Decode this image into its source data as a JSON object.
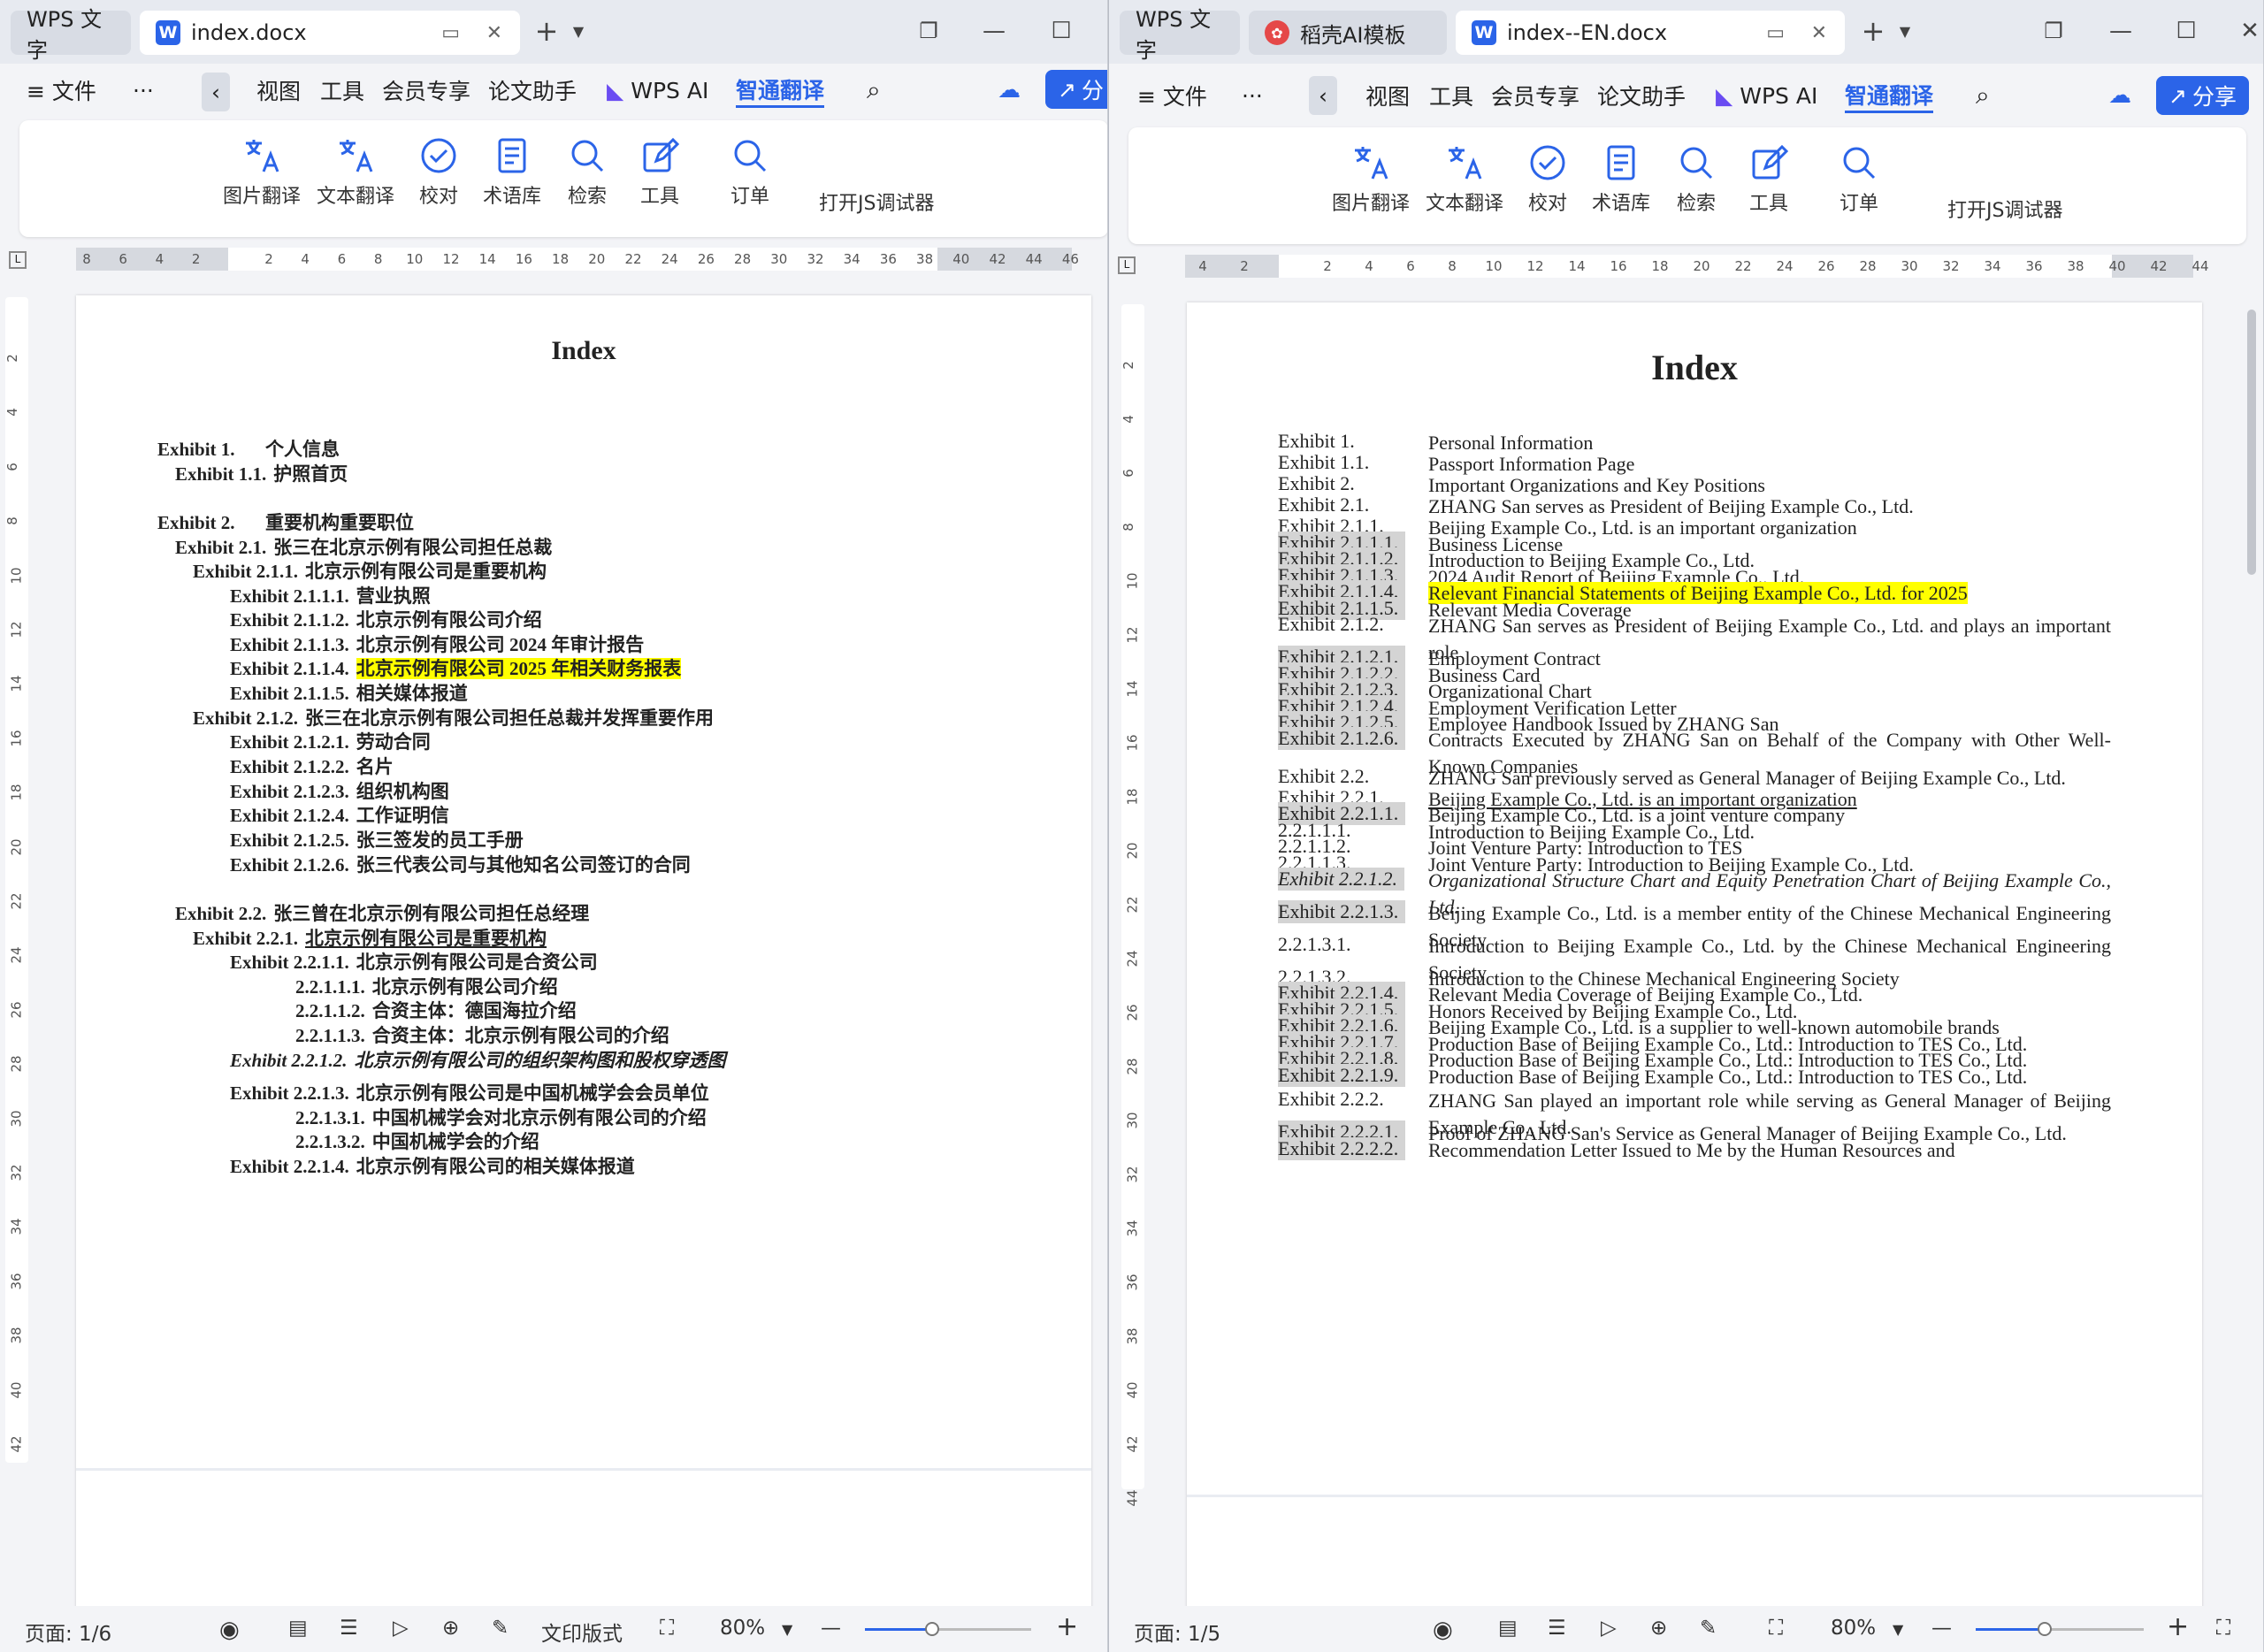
{
  "left": {
    "home_tab": "WPS 文字",
    "doc_tab": "index.docx",
    "menu": {
      "items": [
        "≡  文件",
        "···",
        "视图",
        "工具",
        "会员专享",
        "论文助手",
        "WPS AI",
        "智通翻译"
      ],
      "share_label": "分"
    },
    "ribbon": [
      "图片翻译",
      "文本翻译",
      "校对",
      "术语库",
      "检索",
      "工具",
      "订单",
      "打开JS调试器"
    ],
    "ruler_h": [
      "8",
      "6",
      "4",
      "2",
      "",
      "2",
      "4",
      "6",
      "8",
      "10",
      "12",
      "14",
      "16",
      "18",
      "20",
      "22",
      "24",
      "26",
      "28",
      "30",
      "32",
      "34",
      "36",
      "38",
      "40",
      "42",
      "44",
      "46"
    ],
    "ruler_v": [
      "2",
      "4",
      "6",
      "8",
      "10",
      "12",
      "14",
      "16",
      "18",
      "20",
      "22",
      "24",
      "26",
      "28",
      "30",
      "32",
      "34",
      "36",
      "38",
      "40",
      "42"
    ],
    "doc_title": "Index",
    "entries": [
      {
        "label": "Exhibit 1.",
        "text": "个人信息"
      },
      {
        "label": "Exhibit 1.1.",
        "text": "护照首页"
      },
      {
        "label": "Exhibit 2.",
        "text": "重要机构重要职位"
      },
      {
        "label": "Exhibit 2.1.",
        "text": "张三在北京示例有限公司担任总裁"
      },
      {
        "label": "Exhibit 2.1.1.",
        "text": "北京示例有限公司是重要机构"
      },
      {
        "label": "Exhibit 2.1.1.1.",
        "text": "营业执照"
      },
      {
        "label": "Exhibit 2.1.1.2.",
        "text": "北京示例有限公司介绍"
      },
      {
        "label": "Exhibit 2.1.1.3.",
        "text": "北京示例有限公司 2024 年审计报告"
      },
      {
        "label": "Exhibit 2.1.1.4.",
        "text": "北京示例有限公司 2025 年相关财务报表"
      },
      {
        "label": "Exhibit 2.1.1.5.",
        "text": "相关媒体报道"
      },
      {
        "label": "Exhibit 2.1.2.",
        "text": "张三在北京示例有限公司担任总裁并发挥重要作用"
      },
      {
        "label": "Exhibit 2.1.2.1.",
        "text": "劳动合同"
      },
      {
        "label": "Exhibit 2.1.2.2.",
        "text": "名片"
      },
      {
        "label": "Exhibit 2.1.2.3.",
        "text": "组织机构图"
      },
      {
        "label": "Exhibit 2.1.2.4.",
        "text": "工作证明信"
      },
      {
        "label": "Exhibit 2.1.2.5.",
        "text": "张三签发的员工手册"
      },
      {
        "label": "Exhibit 2.1.2.6.",
        "text": "张三代表公司与其他知名公司签订的合同"
      },
      {
        "label": "Exhibit 2.2.",
        "text": "张三曾在北京示例有限公司担任总经理"
      },
      {
        "label": "Exhibit 2.2.1.",
        "text": "北京示例有限公司是重要机构"
      },
      {
        "label": "Exhibit 2.2.1.1.",
        "text": "北京示例有限公司是合资公司"
      },
      {
        "label": "2.2.1.1.1.",
        "text": "北京示例有限公司介绍"
      },
      {
        "label": "2.2.1.1.2.",
        "text": "合资主体：德国海拉介绍"
      },
      {
        "label": "2.2.1.1.3.",
        "text": "合资主体：北京示例有限公司的介绍"
      },
      {
        "label": "Exhibit 2.2.1.2.",
        "text": "北京示例有限公司的组织架构图和股权穿透图"
      },
      {
        "label": "Exhibit 2.2.1.3.",
        "text": "北京示例有限公司是中国机械学会会员单位"
      },
      {
        "label": "2.2.1.3.1.",
        "text": "中国机械学会对北京示例有限公司的介绍"
      },
      {
        "label": "2.2.1.3.2.",
        "text": "中国机械学会的介绍"
      },
      {
        "label": "Exhibit 2.2.1.4.",
        "text": "北京示例有限公司的相关媒体报道"
      }
    ],
    "status": {
      "page": "页面: 1/6",
      "layout": "文印版式",
      "zoom": "80%"
    }
  },
  "right": {
    "home_tab": "WPS 文字",
    "template_tab": "稻壳AI模板",
    "doc_tab": "index--EN.docx",
    "menu": {
      "items": [
        "≡  文件",
        "···",
        "视图",
        "工具",
        "会员专享",
        "论文助手",
        "WPS AI",
        "智通翻译"
      ],
      "share_label": "分享"
    },
    "ribbon": [
      "图片翻译",
      "文本翻译",
      "校对",
      "术语库",
      "检索",
      "工具",
      "订单",
      "打开JS调试器"
    ],
    "ruler_h": [
      "4",
      "2",
      "",
      "2",
      "4",
      "6",
      "8",
      "10",
      "12",
      "14",
      "16",
      "18",
      "20",
      "22",
      "24",
      "26",
      "28",
      "30",
      "32",
      "34",
      "36",
      "38",
      "40",
      "42",
      "44"
    ],
    "ruler_v": [
      "2",
      "4",
      "6",
      "8",
      "10",
      "12",
      "14",
      "16",
      "18",
      "20",
      "22",
      "24",
      "26",
      "28",
      "30",
      "32",
      "34",
      "36",
      "38",
      "40",
      "42",
      "44"
    ],
    "doc_title": "Index",
    "entries": [
      {
        "label": "Exhibit 1.",
        "text": "Personal Information"
      },
      {
        "label": "Exhibit 1.1.",
        "text": "Passport Information Page"
      },
      {
        "label": "Exhibit 2.",
        "text": "Important Organizations and Key Positions"
      },
      {
        "label": "Exhibit 2.1.",
        "text": "ZHANG San serves as President of Beijing Example Co., Ltd."
      },
      {
        "label": "Exhibit 2.1.1.",
        "text": "Beijing Example Co., Ltd. is an important organization"
      },
      {
        "label": "Exhibit 2.1.1.1.",
        "text": "Business License"
      },
      {
        "label": "Exhibit 2.1.1.2.",
        "text": "Introduction to Beijing Example Co., Ltd."
      },
      {
        "label": "Exhibit 2.1.1.3.",
        "text": "2024 Audit Report of Beijing Example Co., Ltd."
      },
      {
        "label": "Exhibit 2.1.1.4.",
        "text": "Relevant Financial Statements of Beijing Example Co., Ltd. for 2025"
      },
      {
        "label": "Exhibit 2.1.1.5.",
        "text": "Relevant Media Coverage"
      },
      {
        "label": "Exhibit 2.1.2.",
        "text": "ZHANG San serves as President of Beijing Example Co., Ltd. and plays an important role"
      },
      {
        "label": "Exhibit 2.1.2.1.",
        "text": "Employment Contract"
      },
      {
        "label": "Exhibit 2.1.2.2.",
        "text": "Business Card"
      },
      {
        "label": "Exhibit 2.1.2.3.",
        "text": "Organizational Chart"
      },
      {
        "label": "Exhibit 2.1.2.4.",
        "text": "Employment Verification Letter"
      },
      {
        "label": "Exhibit 2.1.2.5.",
        "text": "Employee Handbook Issued by ZHANG San"
      },
      {
        "label": "Exhibit 2.1.2.6.",
        "text": "Contracts Executed by ZHANG San on Behalf of the Company with Other Well-Known Companies"
      },
      {
        "label": "Exhibit 2.2.",
        "text": "ZHANG San previously served as General Manager of Beijing Example Co., Ltd."
      },
      {
        "label": "Exhibit 2.2.1.",
        "text": "Beijing Example Co., Ltd. is an important organization"
      },
      {
        "label": "Exhibit 2.2.1.1.",
        "text": "Beijing Example Co., Ltd. is a joint venture company"
      },
      {
        "label": "2.2.1.1.1.",
        "text": "Introduction to Beijing Example Co., Ltd."
      },
      {
        "label": "2.2.1.1.2.",
        "text": "Joint Venture Party: Introduction to TES"
      },
      {
        "label": "2.2.1.1.3.",
        "text": "Joint Venture Party: Introduction to Beijing Example Co., Ltd."
      },
      {
        "label": "Exhibit 2.2.1.2.",
        "text": "Organizational Structure Chart and Equity Penetration Chart of Beijing Example Co., Ltd."
      },
      {
        "label": "Exhibit 2.2.1.3.",
        "text": "Beijing Example Co., Ltd. is a member entity of the Chinese Mechanical Engineering Society"
      },
      {
        "label": "2.2.1.3.1.",
        "text": "Introduction to Beijing Example Co., Ltd. by the Chinese Mechanical Engineering Society"
      },
      {
        "label": "2.2.1.3.2.",
        "text": "Introduction to the Chinese Mechanical Engineering Society"
      },
      {
        "label": "Exhibit 2.2.1.4.",
        "text": "Relevant Media Coverage of Beijing Example Co., Ltd."
      },
      {
        "label": "Exhibit 2.2.1.5.",
        "text": "Honors Received by Beijing Example Co., Ltd."
      },
      {
        "label": "Exhibit 2.2.1.6.",
        "text": "Beijing Example Co., Ltd. is a supplier to well-known automobile brands"
      },
      {
        "label": "Exhibit 2.2.1.7.",
        "text": "Production Base of Beijing Example Co., Ltd.: Introduction to TES Co., Ltd."
      },
      {
        "label": "Exhibit 2.2.1.8.",
        "text": "Production Base of Beijing Example Co., Ltd.: Introduction to TES Co., Ltd."
      },
      {
        "label": "Exhibit 2.2.1.9.",
        "text": "Production Base of Beijing Example Co., Ltd.: Introduction to TES Co., Ltd."
      },
      {
        "label": "Exhibit 2.2.2.",
        "text": "ZHANG San played an important role while serving as General Manager of Beijing Example Co., Ltd."
      },
      {
        "label": "Exhibit 2.2.2.1.",
        "text": "Proof of ZHANG San's Service as General Manager of Beijing Example Co., Ltd."
      },
      {
        "label": "Exhibit 2.2.2.2.",
        "text": "Recommendation Letter Issued to Me by the Human Resources and"
      }
    ],
    "status": {
      "page": "页面: 1/5",
      "zoom": "80%"
    }
  },
  "colors": {
    "accent": "#2b64e8",
    "highlight": "#ffff00",
    "label_shade": "#d4d4d4"
  }
}
